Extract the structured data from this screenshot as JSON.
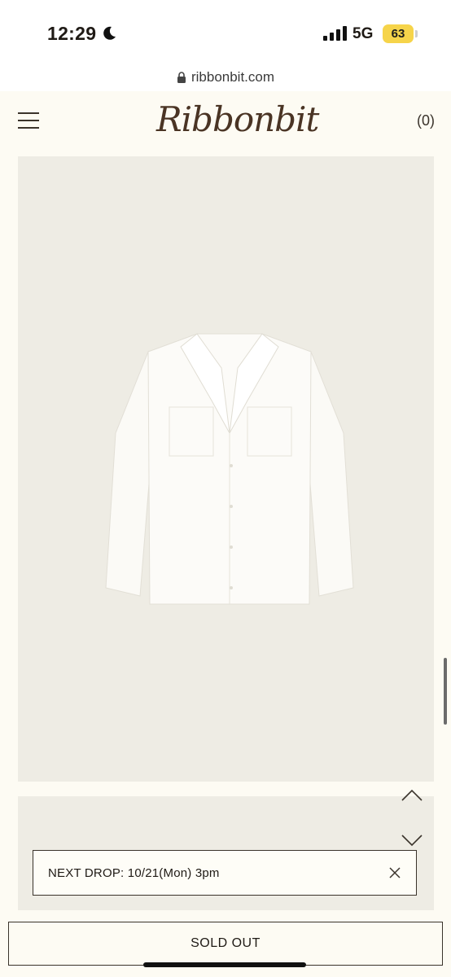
{
  "status_bar": {
    "time": "12:29",
    "network": "5G",
    "battery": "63",
    "icons": [
      "moon-icon",
      "signal-icon"
    ],
    "battery_color": "#f6d44a"
  },
  "browser": {
    "url": "ribbonbit.com",
    "icons": [
      "lock-icon"
    ]
  },
  "header": {
    "logo": "Ribbonbit",
    "cart": "(0)",
    "icons": [
      "menu-icon"
    ]
  },
  "product": {
    "image": "white-blouse-icon",
    "icons": [
      "chevron-up-icon",
      "chevron-down-icon"
    ]
  },
  "notice": {
    "text": "NEXT DROP: 10/21(Mon) 3pm",
    "icons": [
      "close-icon"
    ]
  },
  "bottom_bar": {
    "sold_out_label": "SOLD OUT"
  },
  "colors": {
    "background": "#fdfbf3",
    "card": "#eeece4",
    "logo": "#4a3424",
    "border": "#3a332b"
  }
}
